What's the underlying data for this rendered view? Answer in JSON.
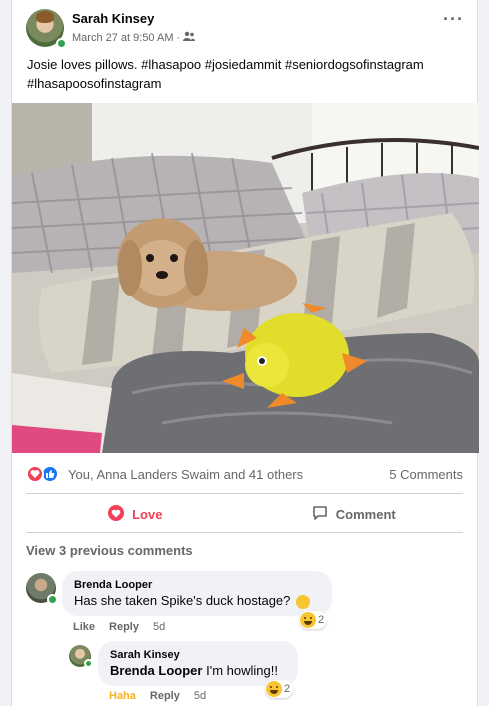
{
  "post": {
    "author": "Sarah Kinsey",
    "timestamp": "March 27 at 9:50 AM",
    "audience_icon": "friends-icon",
    "text": "Josie loves pillows. #lhasapoo #josiedammit #seniordogsofinstagram #lhasapoosofinstagram",
    "photo_icon": "dog-on-pillows-photo"
  },
  "reactions": {
    "summary": "You, Anna Landers Swaim and 41 others",
    "comments_count": "5 Comments",
    "types": [
      "heart-icon",
      "like-icon"
    ]
  },
  "actions": {
    "love_label": "Love",
    "comment_label": "Comment"
  },
  "comments_section": {
    "view_previous": "View 3 previous comments",
    "comments": [
      {
        "name": "Brenda Looper",
        "text": "Has she taken Spike's duck hostage?",
        "emoji": "laughing-emoji",
        "reaction_count": "2",
        "like_label": "Like",
        "reply_label": "Reply",
        "time": "5d"
      },
      {
        "name": "Sarah Kinsey",
        "mention": "Brenda Looper",
        "text": "I'm howling!!",
        "reaction_count": "2",
        "haha_label": "Haha",
        "reply_label": "Reply",
        "time": "5d"
      }
    ]
  },
  "colors": {
    "accent_blue": "#1877f2",
    "love_red": "#f33e58",
    "haha_yellow": "#f7b125",
    "online_green": "#31a24c"
  }
}
